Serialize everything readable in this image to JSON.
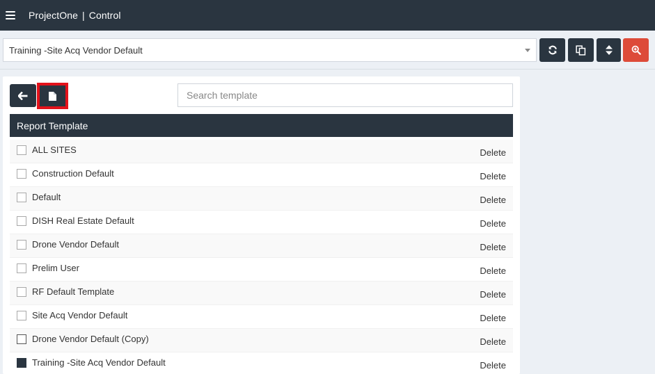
{
  "topbar": {
    "brand": "ProjectOne",
    "separator": "|",
    "section": "Control"
  },
  "toolbar": {
    "selected_template": "Training -Site Acq Vendor Default",
    "buttons": [
      {
        "name": "refresh",
        "icon": "refresh-icon"
      },
      {
        "name": "copy",
        "icon": "copy-icon"
      },
      {
        "name": "sort",
        "icon": "sort-icon"
      },
      {
        "name": "zoom",
        "icon": "zoom-in-icon",
        "color": "#dd4b39"
      }
    ]
  },
  "panel": {
    "search_placeholder": "Search template",
    "table_header": "Report Template",
    "rows": [
      {
        "name": "ALL SITES",
        "action": "Delete",
        "checked": false
      },
      {
        "name": "Construction Default",
        "action": "Delete",
        "checked": false
      },
      {
        "name": "Default",
        "action": "Delete",
        "checked": false
      },
      {
        "name": "DISH Real Estate Default",
        "action": "Delete",
        "checked": false
      },
      {
        "name": "Drone Vendor Default",
        "action": "Delete",
        "checked": false
      },
      {
        "name": "Prelim User",
        "action": "Delete",
        "checked": false
      },
      {
        "name": "RF Default Template",
        "action": "Delete",
        "checked": false
      },
      {
        "name": "Site Acq Vendor Default",
        "action": "Delete",
        "checked": false
      },
      {
        "name": "Drone Vendor Default (Copy)",
        "action": "Delete",
        "checked": false
      },
      {
        "name": "Training -Site Acq Vendor Default",
        "action": "Delete",
        "checked": true
      }
    ]
  },
  "colors": {
    "dark": "#2a3540",
    "danger": "#dd4b39",
    "highlight": "#e3121b",
    "background": "#ecf0f5"
  }
}
